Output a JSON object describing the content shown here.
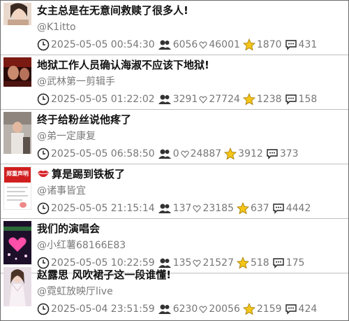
{
  "items": [
    {
      "title": "女主总是在无意间救赎了很多人!",
      "title_emoji": "",
      "author": "@K1itto",
      "timestamp": "2025-05-05 00:54:30",
      "followers": "6056",
      "likes": "46001",
      "stars": "1870",
      "comments": "431",
      "thumb_label": ""
    },
    {
      "title": "地狱工作人员确认海淑不应该下地狱!",
      "title_emoji": "",
      "author": "@武林第一剪辑手",
      "timestamp": "2025-05-05 01:22:02",
      "followers": "3291",
      "likes": "27724",
      "stars": "1238",
      "comments": "158",
      "thumb_label": ""
    },
    {
      "title": "终于给粉丝说他疼了",
      "title_emoji": "",
      "author": "@弟一定康复",
      "timestamp": "2025-05-05 06:58:50",
      "followers": "0",
      "likes": "24887",
      "stars": "3912",
      "comments": "373",
      "thumb_label": ""
    },
    {
      "title": "算是踢到铁板了",
      "title_emoji": "lips",
      "author": "@诸事皆宜",
      "timestamp": "2025-05-05 21:15:14",
      "followers": "137",
      "likes": "23185",
      "stars": "637",
      "comments": "4442",
      "thumb_label": "郑重声明"
    },
    {
      "title": "我们的演唱会",
      "title_emoji": "",
      "author": "@小红薯68166E83",
      "timestamp": "2025-05-05 10:22:59",
      "followers": "135",
      "likes": "21527",
      "stars": "518",
      "comments": "175",
      "thumb_label": ""
    },
    {
      "title": "赵露思 风吹裙子这一段谁懂!",
      "title_emoji": "",
      "author": "@霓虹放映厅live",
      "timestamp": "2025-05-04 23:51:59",
      "followers": "6230",
      "likes": "20056",
      "stars": "2159",
      "comments": "424",
      "thumb_label": ""
    }
  ],
  "icons": {
    "time": "clock-icon",
    "followers": "people-icon",
    "likes": "heart-icon",
    "stars": "star-icon",
    "comments": "comment-icon"
  },
  "colors": {
    "star": "#f5c518",
    "heart_stroke": "#777777",
    "border": "#bfbfbf",
    "lips": "#d8242a"
  }
}
